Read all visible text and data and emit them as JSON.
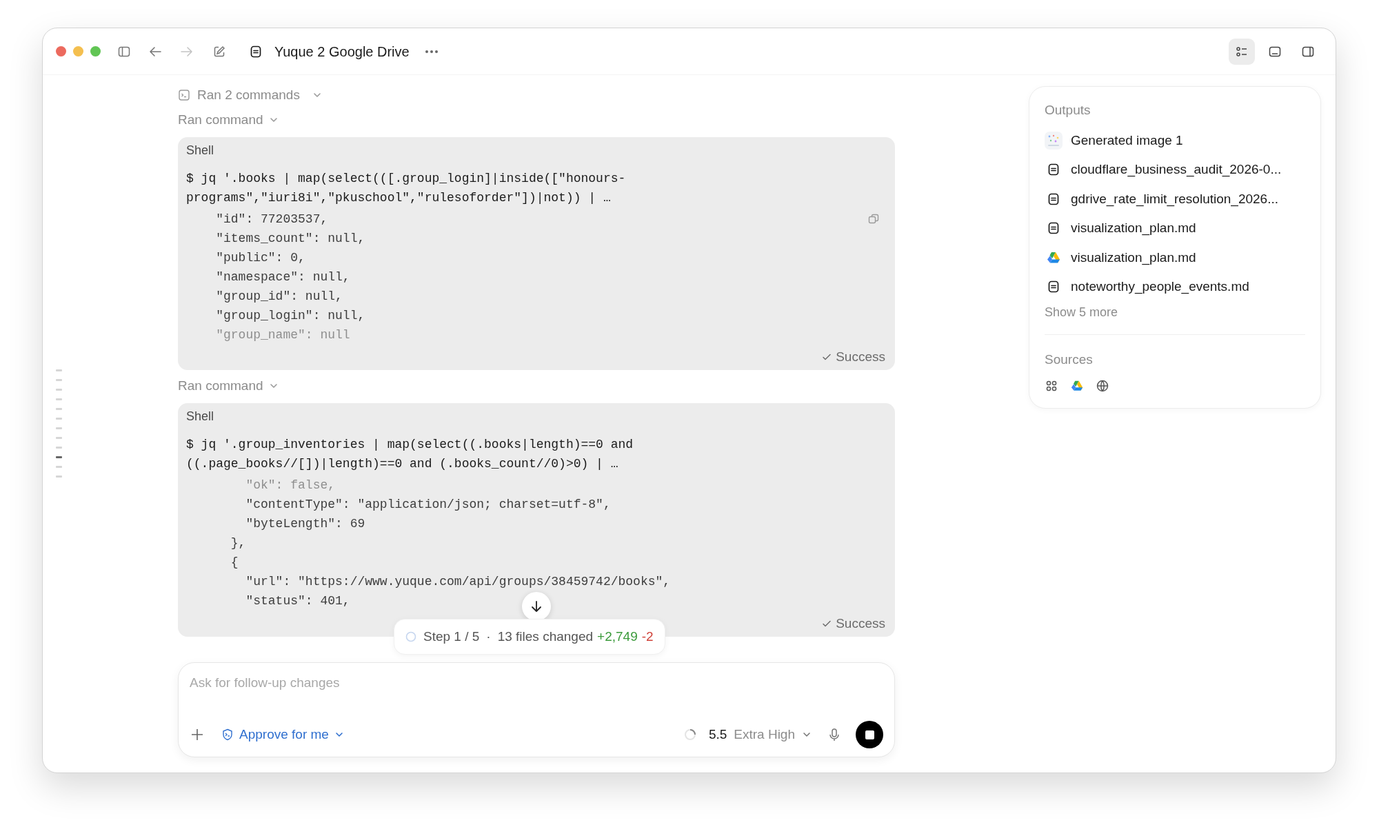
{
  "window": {
    "title": "Yuque 2 Google Drive"
  },
  "view_buttons": [
    {
      "selected": true
    },
    {
      "selected": false
    },
    {
      "selected": false
    }
  ],
  "timeline_marks": [
    {
      "selected": false
    },
    {
      "selected": false
    },
    {
      "selected": false
    },
    {
      "selected": false
    },
    {
      "selected": false
    },
    {
      "selected": false
    },
    {
      "selected": false
    },
    {
      "selected": false
    },
    {
      "selected": false
    },
    {
      "selected": true
    },
    {
      "selected": false
    },
    {
      "selected": false
    }
  ],
  "activity": {
    "summary": "Ran 2 commands"
  },
  "commands": [
    {
      "header": "Ran command",
      "shell_label": "Shell",
      "command": [
        "$ jq '.books | map(select(([.group_login]|inside([\"honours-",
        "programs\",\"iuri8i\",\"pkuschool\",\"rulesoforder\"])|not)) | …"
      ],
      "output": [
        {
          "text": "    \"id\": 77203537,",
          "faded": false
        },
        {
          "text": "    \"items_count\": null,",
          "faded": false
        },
        {
          "text": "    \"public\": 0,",
          "faded": false
        },
        {
          "text": "    \"namespace\": null,",
          "faded": false
        },
        {
          "text": "    \"group_id\": null,",
          "faded": false
        },
        {
          "text": "    \"group_login\": null,",
          "faded": false
        },
        {
          "text": "    \"group_name\": null",
          "faded": true
        }
      ],
      "status": "Success"
    },
    {
      "header": "Ran command",
      "shell_label": "Shell",
      "command": [
        "$ jq '.group_inventories | map(select((.books|length)==0 and",
        "((.page_books//[])|length)==0 and (.books_count//0)>0) | …"
      ],
      "output": [
        {
          "text": "        \"ok\": false,",
          "faded": true
        },
        {
          "text": "        \"contentType\": \"application/json; charset=utf-8\",",
          "faded": false
        },
        {
          "text": "        \"byteLength\": 69",
          "faded": false
        },
        {
          "text": "      },",
          "faded": false
        },
        {
          "text": "      {",
          "faded": false
        },
        {
          "text": "        \"url\": \"https://www.yuque.com/api/groups/38459742/books\",",
          "faded": false
        },
        {
          "text": "        \"status\": 401,",
          "faded": false
        }
      ],
      "status": "Success"
    }
  ],
  "progress": {
    "step": "Step 1 / 5",
    "separator": "·",
    "files": "13 files changed",
    "added": "+2,749",
    "removed": "-2"
  },
  "composer": {
    "placeholder": "Ask for follow-up changes",
    "approval": "Approve for me",
    "model": "5.5",
    "effort": "Extra High"
  },
  "outputs": {
    "title": "Outputs",
    "items": [
      {
        "name": "Generated image 1"
      },
      {
        "kind": "document",
        "name": "cloudflare_business_audit_2026-0..."
      },
      {
        "kind": "document",
        "name": "gdrive_rate_limit_resolution_2026..."
      },
      {
        "kind": "document",
        "name": "visualization_plan.md"
      },
      {
        "kind": "drive",
        "name": "visualization_plan.md"
      },
      {
        "kind": "document",
        "name": "noteworthy_people_events.md"
      }
    ],
    "show_more": "Show 5 more"
  },
  "sources": {
    "title": "Sources",
    "items": [
      {
        "kind": "connector"
      },
      {
        "kind": "drive"
      },
      {
        "kind": "web"
      }
    ]
  }
}
